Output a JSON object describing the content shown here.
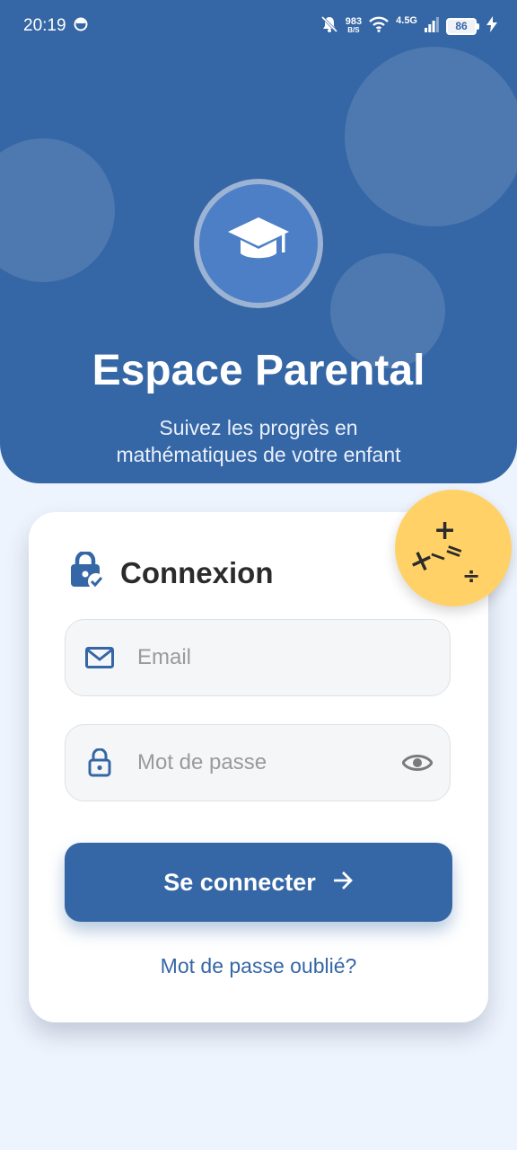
{
  "status_bar": {
    "time": "20:19",
    "net_speed_value": "983",
    "net_speed_unit": "B/S",
    "network_type": "4.5G",
    "battery": "86",
    "icons": [
      "notification-dot-icon",
      "bell-off-icon",
      "wifi-icon",
      "signal-icon",
      "battery-icon",
      "charging-bolt-icon"
    ]
  },
  "header": {
    "logo_icon": "graduation-cap-icon",
    "title": "Espace Parental",
    "subtitle_line1": "Suivez les progrès en",
    "subtitle_line2": "mathématiques de votre enfant"
  },
  "login": {
    "heading": "Connexion",
    "heading_icon": "lock-check-icon",
    "email_placeholder": "Email",
    "email_icon": "envelope-icon",
    "password_placeholder": "Mot de passe",
    "password_icon": "lock-icon",
    "toggle_icon": "eye-icon",
    "submit_label": "Se connecter",
    "submit_icon": "arrow-right-icon",
    "forgot_link": "Mot de passe oublié?"
  },
  "math_badge": {
    "symbols": [
      "+",
      "×",
      "−",
      "=",
      "÷"
    ]
  },
  "colors": {
    "primary": "#3566a5",
    "logo_circle": "#4d7fc6",
    "badge": "#ffd166",
    "background": "#eef4fd",
    "card": "#ffffff"
  }
}
